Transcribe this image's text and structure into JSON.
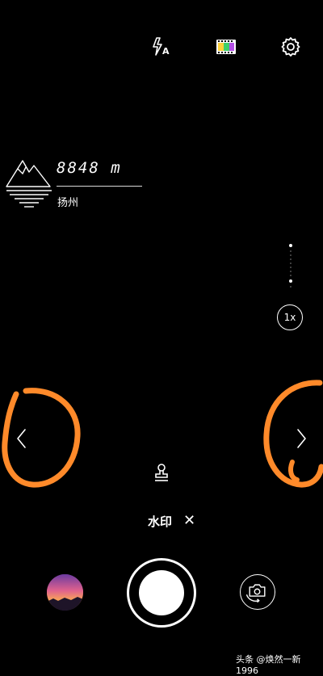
{
  "toolbar": {
    "flash_icon": "flash-auto-icon",
    "filter_icon": "filter-icon",
    "settings_icon": "gear-icon"
  },
  "watermark": {
    "altitude": "8848 m",
    "location": "扬州",
    "icon": "mountain-icon"
  },
  "zoom": {
    "label": "1x",
    "level": 1
  },
  "arrows": {
    "left_icon": "chevron-left-icon",
    "right_icon": "chevron-right-icon"
  },
  "annotations": {
    "color": "#ff8a2a"
  },
  "watermark_bar": {
    "label": "水印",
    "close_glyph": "✕"
  },
  "bottom": {
    "gallery_icon": "gallery-thumbnail",
    "switch_camera_icon": "switch-camera-icon"
  },
  "credit": "头条 @焕然一新1996"
}
